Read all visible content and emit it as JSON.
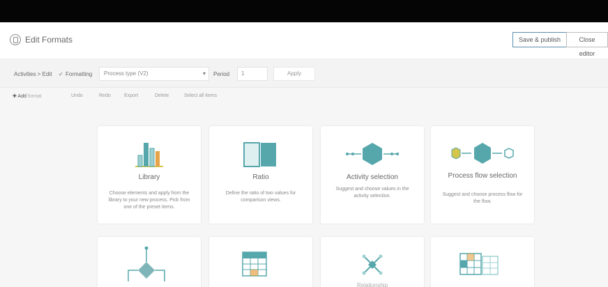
{
  "app": {
    "title": "Edit Formats"
  },
  "header": {
    "primary_button": "Save & publish",
    "secondary_button": "Close editor"
  },
  "toolbar": {
    "breadcrumb": "Activities > Edit",
    "check": "✓",
    "formatting_label": "Formatting",
    "template_value": "Process type (V2)",
    "period_label": "Period",
    "period_value": "1",
    "apply_label": "Apply"
  },
  "actions": [
    {
      "label": "✚ Add",
      "extra": "format"
    },
    {
      "label": "Undo"
    },
    {
      "label": "Redo"
    },
    {
      "label": "Export"
    },
    {
      "label": "Delete"
    },
    {
      "label": "Select all items"
    }
  ],
  "cards": [
    {
      "title": "Library",
      "desc": "Choose elements and apply from the library to your new process. Pick from one of the preset items."
    },
    {
      "title": "Ratio",
      "desc": "Define the ratio of two values for comparison views."
    },
    {
      "title": "Activity selection",
      "desc": "Suggest and choose values in the activity selection."
    },
    {
      "title": "Process flow selection",
      "desc": "Suggest and choose process flow for the flow."
    },
    {
      "title": "",
      "desc": ""
    },
    {
      "title": "",
      "desc": ""
    },
    {
      "title": "Relationship",
      "desc": ""
    },
    {
      "title": "",
      "desc": ""
    }
  ],
  "colors": {
    "teal": "#56a7ac",
    "teal_light": "#9fd0d0",
    "orange": "#e6a347",
    "yellow": "#d4c64a"
  },
  "icons": [
    "logo-icon",
    "bar-chart-icon",
    "split-panel-icon",
    "activity-node-icon",
    "process-flow-icon",
    "decision-flow-icon",
    "table-grid-icon",
    "relationship-icon",
    "multi-grid-icon"
  ]
}
